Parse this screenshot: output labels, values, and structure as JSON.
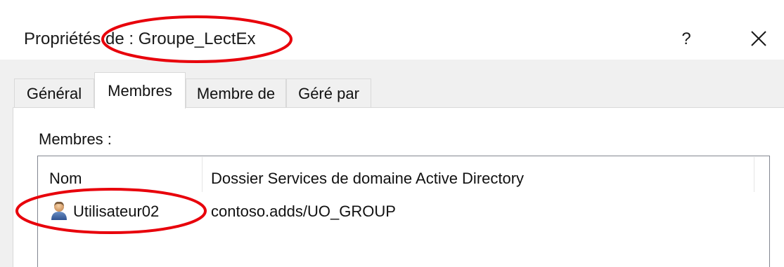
{
  "window": {
    "title": "Propriétés de : Groupe_LectEx",
    "help_label": "?",
    "close_icon": "close-icon"
  },
  "tabs": [
    {
      "label": "Général",
      "active": false
    },
    {
      "label": "Membres",
      "active": true
    },
    {
      "label": "Membre de",
      "active": false
    },
    {
      "label": "Géré par",
      "active": false
    }
  ],
  "members": {
    "label": "Membres :",
    "columns": [
      "Nom",
      "Dossier Services de domaine Active Directory"
    ],
    "rows": [
      {
        "icon": "user-icon",
        "name": "Utilisateur02",
        "folder": "contoso.adds/UO_GROUP"
      }
    ]
  },
  "annotations": {
    "color": "#e8000b"
  }
}
